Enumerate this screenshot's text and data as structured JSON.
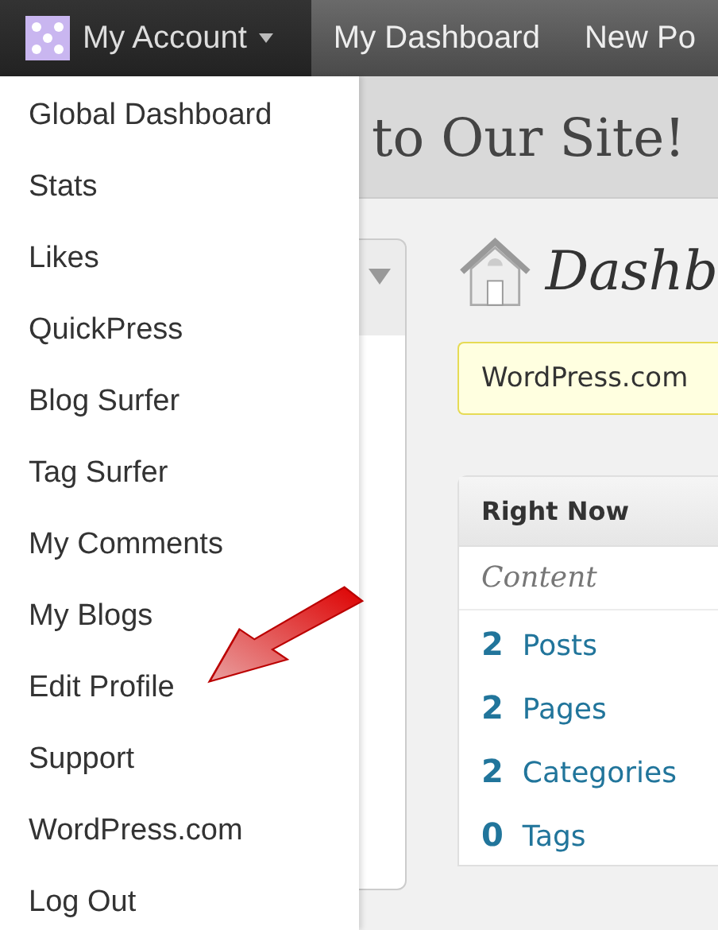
{
  "top_bar": {
    "account": {
      "label": "My Account",
      "expanded": true
    },
    "items": [
      {
        "label": "My Dashboard"
      },
      {
        "label": "New Po"
      }
    ]
  },
  "account_menu": [
    "Global Dashboard",
    "Stats",
    "Likes",
    "QuickPress",
    "Blog Surfer",
    "Tag Surfer",
    "My Comments",
    "My Blogs",
    "Edit Profile",
    "Support",
    "WordPress.com",
    "Log Out"
  ],
  "site_title": "to Our Site!",
  "page_heading": "Dashb",
  "notice": "WordPress.com",
  "right_now": {
    "title": "Right Now",
    "section": "Content",
    "rows": [
      {
        "count": "2",
        "label": "Posts"
      },
      {
        "count": "2",
        "label": "Pages"
      },
      {
        "count": "2",
        "label": "Categories"
      },
      {
        "count": "0",
        "label": "Tags"
      }
    ]
  }
}
